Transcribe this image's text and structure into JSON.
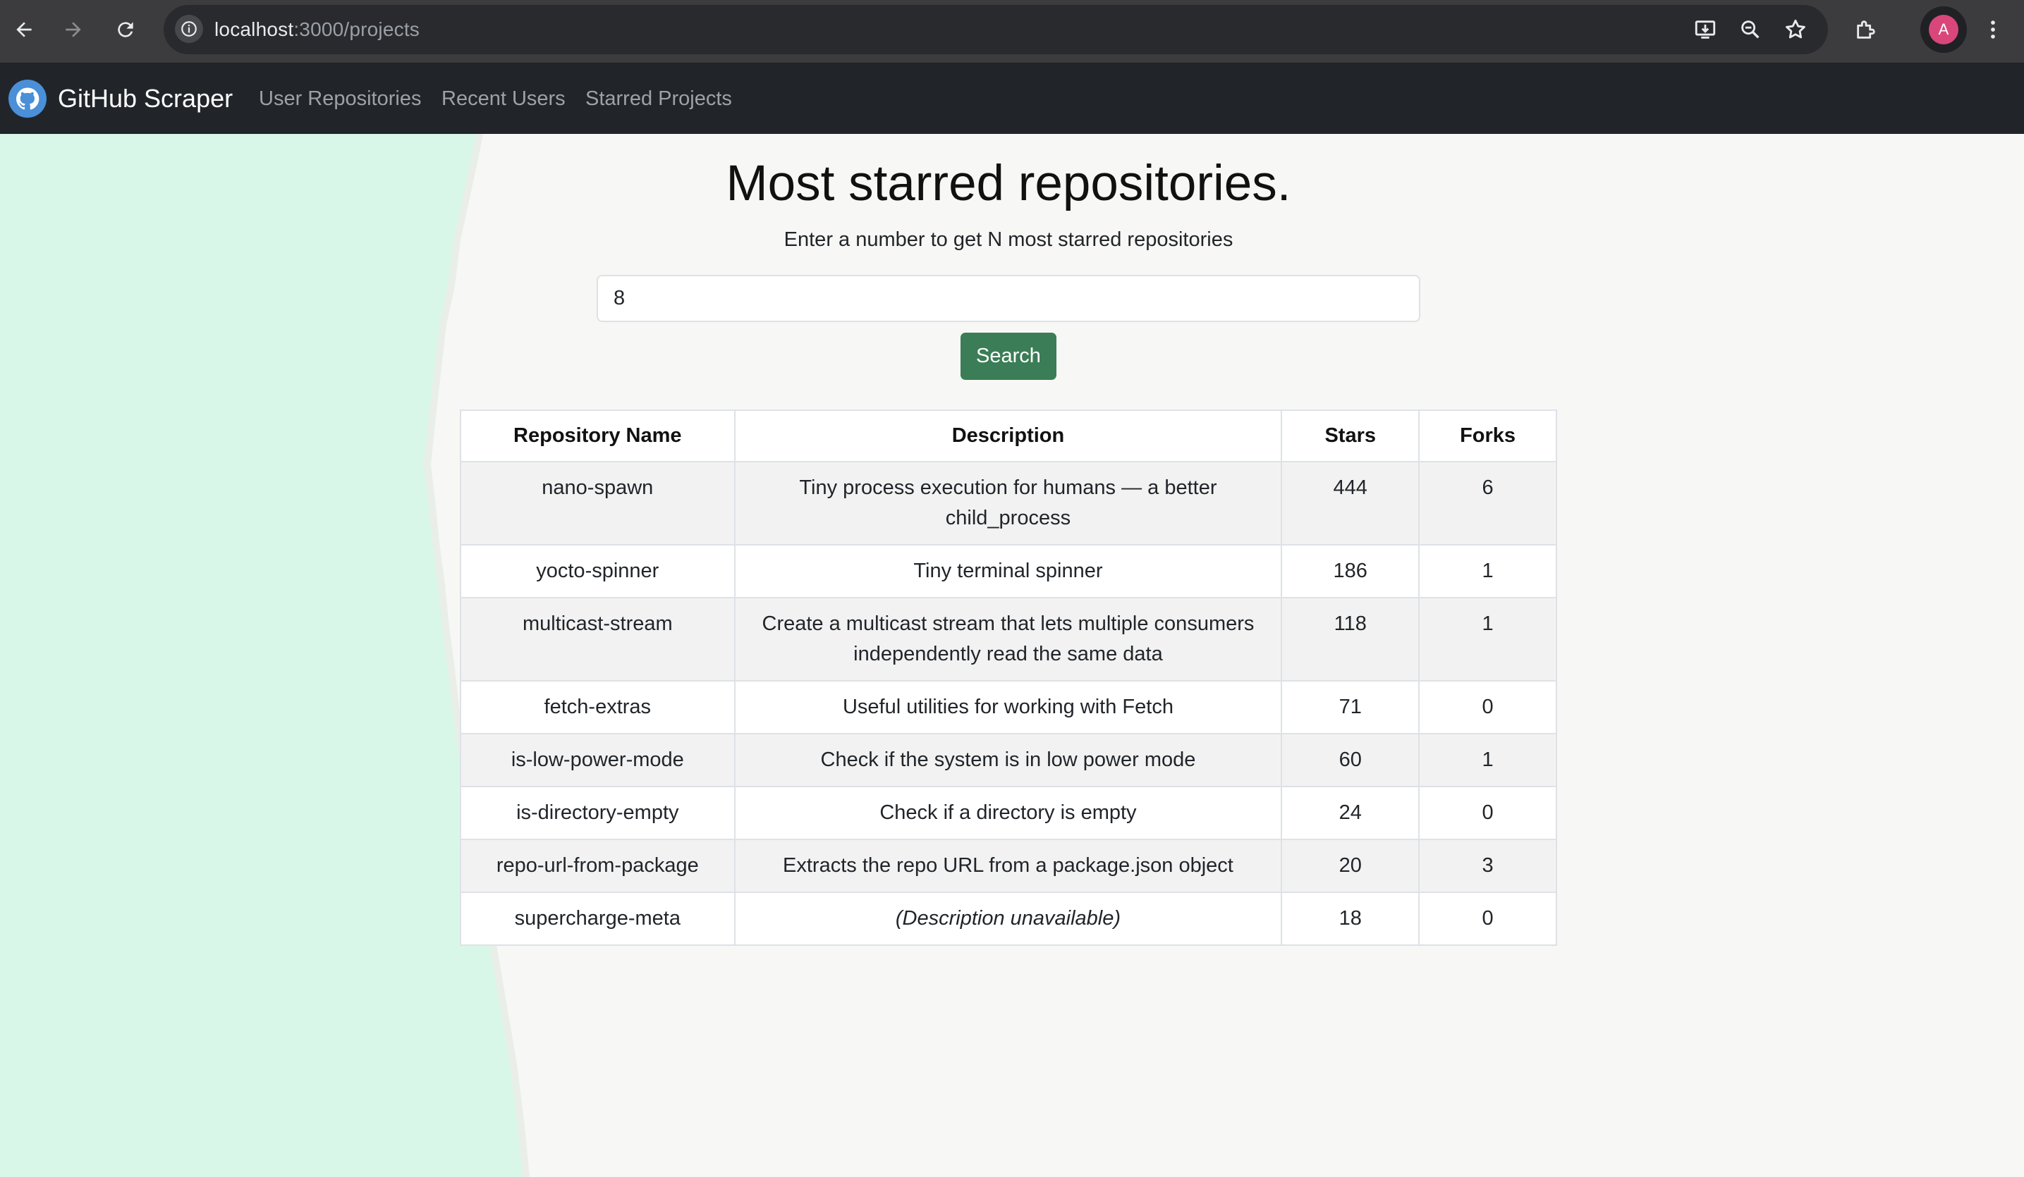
{
  "browser": {
    "url_host": "localhost",
    "url_path": ":3000/projects",
    "profile_initial": "A"
  },
  "navbar": {
    "brand": "GitHub Scraper",
    "links": [
      "User Repositories",
      "Recent Users",
      "Starred Projects"
    ]
  },
  "main": {
    "title": "Most starred repositories.",
    "subtitle": "Enter a number to get N most starred repositories",
    "count_value": "8",
    "search_label": "Search"
  },
  "table": {
    "headers": [
      "Repository Name",
      "Description",
      "Stars",
      "Forks"
    ],
    "rows": [
      {
        "name": "nano-spawn",
        "description": "Tiny process execution for humans — a better child_process",
        "stars": "444",
        "forks": "6"
      },
      {
        "name": "yocto-spinner",
        "description": "Tiny terminal spinner",
        "stars": "186",
        "forks": "1"
      },
      {
        "name": "multicast-stream",
        "description": "Create a multicast stream that lets multiple consumers independently read the same data",
        "stars": "118",
        "forks": "1"
      },
      {
        "name": "fetch-extras",
        "description": "Useful utilities for working with Fetch",
        "stars": "71",
        "forks": "0"
      },
      {
        "name": "is-low-power-mode",
        "description": "Check if the system is in low power mode",
        "stars": "60",
        "forks": "1"
      },
      {
        "name": "is-directory-empty",
        "description": "Check if a directory is empty",
        "stars": "24",
        "forks": "0"
      },
      {
        "name": "repo-url-from-package",
        "description": "Extracts the repo URL from a package.json object",
        "stars": "20",
        "forks": "3"
      },
      {
        "name": "supercharge-meta",
        "description": "(Description unavailable)",
        "stars": "18",
        "forks": "0"
      }
    ]
  },
  "colors": {
    "navbar_bg": "#212529",
    "button_green": "#3a7d56",
    "background_mint": "#d9f7e8",
    "background_paper": "#f7f7f5"
  }
}
